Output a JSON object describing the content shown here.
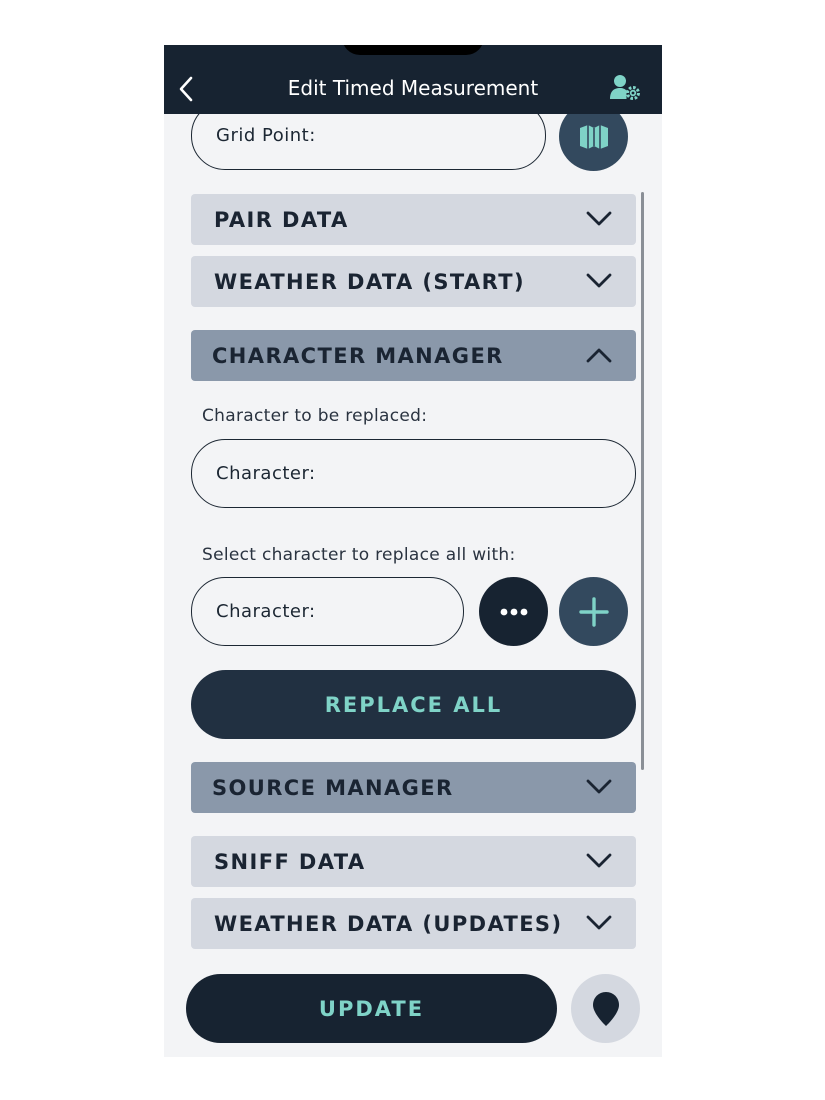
{
  "header": {
    "title": "Edit Timed Measurement",
    "back_icon": "chevron-left-icon",
    "profile_icon": "user-gear-icon"
  },
  "grid_point": {
    "label": "Grid Point:",
    "map_icon": "map-icon"
  },
  "sections": {
    "pair_data": "PAIR DATA",
    "weather_start": "WEATHER DATA (START)",
    "character_manager": "CHARACTER MANAGER",
    "source_manager": "SOURCE MANAGER",
    "sniff_data": "SNIFF DATA",
    "weather_updates": "WEATHER DATA (UPDATES)"
  },
  "character_manager": {
    "replace_caption": "Character to be replaced:",
    "replace_field_label": "Character:",
    "select_caption": "Select character to replace all with:",
    "select_field_label": "Character:",
    "replace_all_label": "REPLACE ALL"
  },
  "footer": {
    "update_label": "UPDATE",
    "location_icon": "map-pin-icon"
  },
  "colors": {
    "header_bg": "#172331",
    "accent_text": "#7fd3c7",
    "section_light": "#d4d8e0",
    "section_active": "#8a98aa",
    "button_dark": "#213041",
    "teal_icon": "#7fd3c7"
  }
}
